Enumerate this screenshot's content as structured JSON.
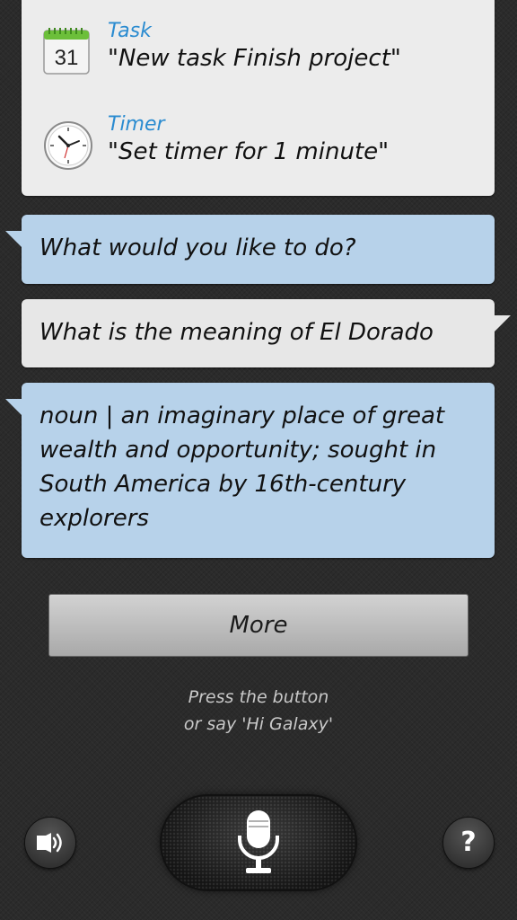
{
  "suggestions": [
    {
      "category": "Task",
      "command": "\"New task Finish project\"",
      "icon": "calendar-icon",
      "icon_text": "31"
    },
    {
      "category": "Timer",
      "command": "\"Set timer for 1 minute\"",
      "icon": "clock-icon"
    }
  ],
  "conversation": {
    "prompt": "What would you like to do?",
    "user_query": "What is the meaning of El Dorado",
    "answer": "noun | an imaginary place of great wealth and opportunity; sought in South America by 16th-century explorers"
  },
  "more_button": "More",
  "hint": {
    "line1": "Press the button",
    "line2": "or say 'Hi Galaxy'"
  },
  "controls": {
    "left": "speaker-icon",
    "center": "microphone-icon",
    "right": "?"
  },
  "colors": {
    "accent": "#2a8bd0",
    "assistant_bubble": "#b7d2ea",
    "user_bubble": "#e7e7e7",
    "background": "#2b2b2b"
  }
}
